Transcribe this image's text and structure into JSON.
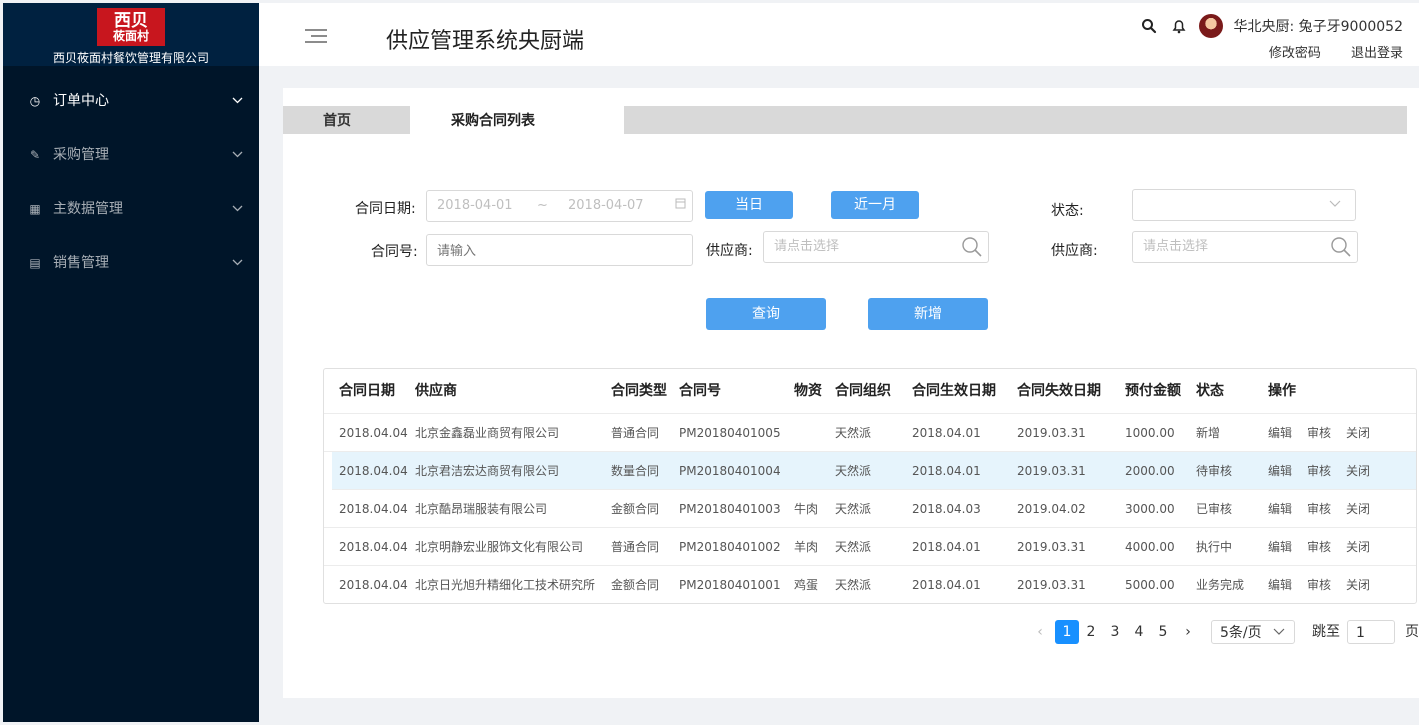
{
  "logo": {
    "line1": "西贝",
    "line2": "莜面村"
  },
  "company": "西贝莜面村餐饮管理有限公司",
  "menu": [
    {
      "label": "订单中心",
      "icon": "dashboard-icon",
      "glyph": "◷"
    },
    {
      "label": "采购管理",
      "icon": "edit-icon",
      "glyph": "✎"
    },
    {
      "label": "主数据管理",
      "icon": "table-icon",
      "glyph": "▦"
    },
    {
      "label": "销售管理",
      "icon": "list-icon",
      "glyph": "▤"
    }
  ],
  "header": {
    "title": "供应管理系统央厨端",
    "user": "华北央厨: 兔子牙9000052",
    "change_password": "修改密码",
    "logout": "退出登录"
  },
  "tabs": {
    "home": "首页",
    "contract_list": "采购合同列表"
  },
  "filters": {
    "contract_date_label": "合同日期:",
    "date_start": "2018-04-01",
    "date_sep": "~",
    "date_end": "2018-04-07",
    "today_btn": "当日",
    "last_month_btn": "近一月",
    "status_label": "状态:",
    "status_value": "",
    "contract_no_label": "合同号:",
    "contract_no_placeholder": "请输入",
    "supplier_label": "供应商:",
    "supplier_placeholder": "请点击选择",
    "supplier2_label": "供应商:",
    "supplier2_placeholder": "请点击选择",
    "query_btn": "查询",
    "add_btn": "新增"
  },
  "table": {
    "headers": [
      "合同日期",
      "供应商",
      "合同类型",
      "合同号",
      "物资",
      "合同组织",
      "合同生效日期",
      "合同失效日期",
      "预付金额",
      "状态",
      "操作"
    ],
    "rows": [
      {
        "date": "2018.04.04",
        "supplier": "北京金鑫磊业商贸有限公司",
        "type": "普通合同",
        "no": "PM20180401005",
        "material": "",
        "org": "天然派",
        "start": "2018.04.01",
        "end": "2019.03.31",
        "amount": "1000.00",
        "status": "新增"
      },
      {
        "date": "2018.04.04",
        "supplier": "北京君洁宏达商贸有限公司",
        "type": "数量合同",
        "no": "PM20180401004",
        "material": "",
        "org": "天然派",
        "start": "2018.04.01",
        "end": "2019.03.31",
        "amount": "2000.00",
        "status": "待审核"
      },
      {
        "date": "2018.04.04",
        "supplier": "北京酷昂瑞服装有限公司",
        "type": "金额合同",
        "no": "PM20180401003",
        "material": "牛肉",
        "org": "天然派",
        "start": "2018.04.03",
        "end": "2019.04.02",
        "amount": "3000.00",
        "status": "已审核"
      },
      {
        "date": "2018.04.04",
        "supplier": "北京明静宏业服饰文化有限公司",
        "type": "普通合同",
        "no": "PM20180401002",
        "material": "羊肉",
        "org": "天然派",
        "start": "2018.04.01",
        "end": "2019.03.31",
        "amount": "4000.00",
        "status": "执行中"
      },
      {
        "date": "2018.04.04",
        "supplier": "北京日光旭升精细化工技术研究所",
        "type": "金额合同",
        "no": "PM20180401001",
        "material": "鸡蛋",
        "org": "天然派",
        "start": "2018.04.01",
        "end": "2019.03.31",
        "amount": "5000.00",
        "status": "业务完成"
      }
    ],
    "highlighted_row": 1,
    "ops": {
      "edit": "编辑",
      "review": "审核",
      "close": "关闭"
    }
  },
  "pagination": {
    "prev": "‹",
    "pages": [
      "1",
      "2",
      "3",
      "4",
      "5"
    ],
    "current": "1",
    "next": "›",
    "page_size": "5条/页",
    "jump_label": "跳至",
    "jump_value": "1",
    "page_suffix": "页"
  },
  "colors": {
    "sidebar": "#001529",
    "accent": "#4ea1ef",
    "active_page": "#1890ff",
    "row_highlight": "#e6f4fc"
  }
}
